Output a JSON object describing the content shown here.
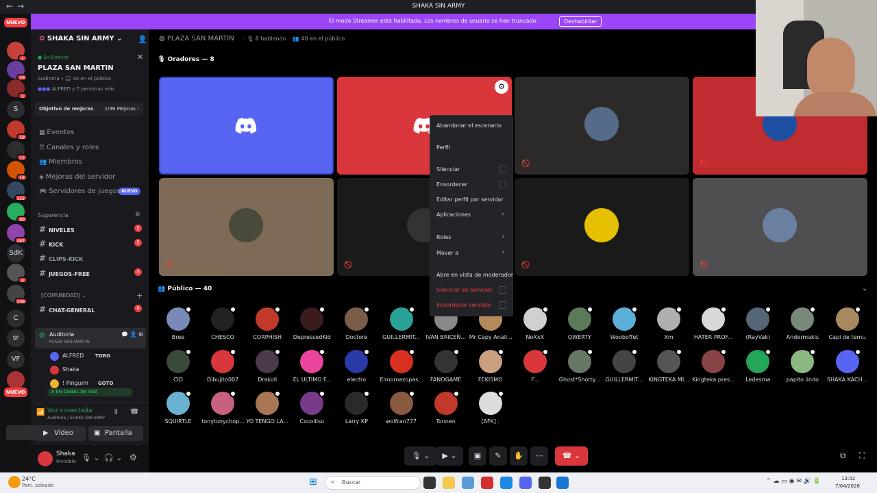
{
  "window": {
    "title": "SHAKA SIN ARMY",
    "back": "←",
    "forward": "→"
  },
  "banner": {
    "message": "El modo Streamer está habilitado. Los nombres de usuario se han truncado.",
    "button": "Deshabilitar"
  },
  "guilds": {
    "nuevo_top": "NUEVO",
    "nuevo_bottom": "NUEVO",
    "items": [
      {
        "label": "",
        "badge": "1",
        "color": "#c7403a"
      },
      {
        "label": "",
        "badge": "26",
        "color": "#6b3fa0"
      },
      {
        "label": "",
        "badge": "1",
        "color": "#8a2a2a"
      },
      {
        "label": "S",
        "badge": "",
        "color": "#2b2d31"
      },
      {
        "label": "",
        "badge": "19",
        "color": "#c0392b"
      },
      {
        "label": "",
        "badge": "12",
        "color": "#2d2d2d"
      },
      {
        "label": "",
        "badge": "18",
        "color": "#d35400"
      },
      {
        "label": "",
        "badge": "115",
        "color": "#34495e"
      },
      {
        "label": "",
        "badge": "30",
        "color": "#27ae60"
      },
      {
        "label": "",
        "badge": "287",
        "color": "#8e44ad"
      },
      {
        "label": "SdK",
        "badge": "",
        "color": "#2b2d31"
      },
      {
        "label": "",
        "badge": "4",
        "color": "#555"
      },
      {
        "label": "",
        "badge": "256",
        "color": "#444"
      },
      {
        "label": "C",
        "badge": "",
        "color": "#2b2d31"
      },
      {
        "label": "sr",
        "badge": "",
        "color": "#2b2d31"
      },
      {
        "label": "VF",
        "badge": "",
        "color": "#2b2d31"
      },
      {
        "label": "",
        "badge": "",
        "color": "#a33"
      }
    ]
  },
  "sidebar": {
    "server_name": "SHAKA SIN ARMY",
    "live_label": "En Directo",
    "stage_name": "PLAZA SAN MARTIN",
    "stage_meta": "Auditoria • 🎧 40 en el público",
    "stage_people": "ALFRED y 7 personas más",
    "boost_goal": "Objetivo de mejoras",
    "boost_count": "1/36 Mejoras",
    "menu": [
      {
        "label": "Eventos",
        "icon": "calendar-icon"
      },
      {
        "label": "Canales y roles",
        "icon": "list-icon"
      },
      {
        "label": "Miembros",
        "icon": "members-icon"
      },
      {
        "label": "Mejoras del servidor",
        "icon": "boost-icon"
      },
      {
        "label": "Servidores de juegos",
        "icon": "gamepad-icon"
      }
    ],
    "games_badge": "NUEVO",
    "suggestion_label": "Sugerencia",
    "channels": [
      {
        "name": "NIVELES",
        "badge": "2"
      },
      {
        "name": "KICK",
        "badge": "5"
      },
      {
        "name": "CLIPS-KICK",
        "badge": ""
      },
      {
        "name": "JUEGOS-FREE",
        "badge": "3"
      }
    ],
    "category": "[COMUNIDAD]",
    "general_channel": {
      "name": "CHAT-GENERAL",
      "badge": "4"
    },
    "voice_channel": {
      "name": "Auditoria",
      "sub": "PLAZA SAN MARTIN"
    },
    "voice_users": [
      {
        "name": "ALFRED",
        "tag": "TORO"
      },
      {
        "name": "Shaka",
        "tag": ""
      },
      {
        "name": "! Pinguim",
        "tag": "GOTO"
      }
    ],
    "in_voice_pill": "8 EN CANAL DE VOZ"
  },
  "voice_panel": {
    "status": "Voz conectada",
    "location": "Auditoria / SHAKA SIN ARMY",
    "video_button": "Video",
    "screen_button": "Pantalla"
  },
  "user_panel": {
    "name": "Shaka",
    "status": "Invisible"
  },
  "stage_header": {
    "name": "PLAZA SAN MARTIN",
    "speaking": "8 hablando",
    "audience": "40 en el público"
  },
  "speakers": {
    "title": "Oradores — 8",
    "tiles": [
      {
        "bg": "#5865f2",
        "kind": "logo",
        "muted": false
      },
      {
        "bg": "#da373c",
        "kind": "logo",
        "muted": false
      },
      {
        "bg": "#2b2a28",
        "kind": "avatar",
        "avatar_color": "#556b8a",
        "muted": true
      },
      {
        "bg": "#c02c2f",
        "kind": "avatar",
        "avatar_color": "#1f4fa3",
        "muted": true
      },
      {
        "bg": "#7d6b58",
        "kind": "avatar",
        "avatar_color": "#4a4a3a",
        "muted": true
      },
      {
        "bg": "#1a1a1a",
        "kind": "avatar",
        "avatar_color": "#333",
        "muted": true
      },
      {
        "bg": "#1a1a1a",
        "kind": "avatar",
        "avatar_color": "#e6c000",
        "muted": true
      },
      {
        "bg": "#4f4f52",
        "kind": "avatar",
        "avatar_color": "#6b7fa0",
        "muted": true
      }
    ]
  },
  "audience": {
    "title": "Público — 40",
    "members": [
      {
        "name": "Bree",
        "color": "#7a8ab8"
      },
      {
        "name": "CHESCO",
        "color": "#222"
      },
      {
        "name": "CORPHISH",
        "color": "#c0392b"
      },
      {
        "name": "DepressedKid",
        "color": "#3a1c1c"
      },
      {
        "name": "Doctore",
        "color": "#7a5c48"
      },
      {
        "name": "GUILLERMIT...",
        "color": "#2aa198"
      },
      {
        "name": "IVAN BRICEÑ...",
        "color": "#888"
      },
      {
        "name": "Mr Capy Anali...",
        "color": "#b58a5a"
      },
      {
        "name": "NoXxX",
        "color": "#d0d0d0"
      },
      {
        "name": "QWERTY",
        "color": "#5a7a5a"
      },
      {
        "name": "Wooboffet",
        "color": "#5ab0d8"
      },
      {
        "name": "Xm",
        "color": "#b0b0b0"
      },
      {
        "name": "HATER PROF...",
        "color": "#d8d8d8"
      },
      {
        "name": "(RayVak)",
        "color": "#556677"
      },
      {
        "name": "Andermakis",
        "color": "#7a8a7a"
      },
      {
        "name": "Capi de temu",
        "color": "#a88860"
      },
      {
        "name": "CID",
        "color": "#3a4a3a"
      },
      {
        "name": "Dibujito007",
        "color": "#da373c"
      },
      {
        "name": "Drakoll",
        "color": "#4a3a4a"
      },
      {
        "name": "EL ULTIMO F...",
        "color": "#eb459e"
      },
      {
        "name": "electro",
        "color": "#2a3aa8"
      },
      {
        "name": "Elmomazopas...",
        "color": "#d83020"
      },
      {
        "name": "FANOGAME",
        "color": "#333"
      },
      {
        "name": "FEKISMO",
        "color": "#c9a080"
      },
      {
        "name": "F...",
        "color": "#da373c"
      },
      {
        "name": "Ghost*Shorty...",
        "color": "#667766"
      },
      {
        "name": "GUILLERMIT...",
        "color": "#444"
      },
      {
        "name": "KINGTEKA MI...",
        "color": "#555"
      },
      {
        "name": "Kingteka pres...",
        "color": "#884444"
      },
      {
        "name": "Ledesma",
        "color": "#23a55a"
      },
      {
        "name": "papito lindo",
        "color": "#8ab880"
      },
      {
        "name": "SHAKA KACH...",
        "color": "#5865f2"
      },
      {
        "name": "SQUIRTLE",
        "color": "#6ab0d0"
      },
      {
        "name": "tonytonychop...",
        "color": "#c86080"
      },
      {
        "name": "YO TENGO LA...",
        "color": "#aa7755"
      },
      {
        "name": "Cocolilso",
        "color": "#7a3a8a"
      },
      {
        "name": "Larry KP",
        "color": "#2a2a2a"
      },
      {
        "name": "wolfran777",
        "color": "#8a5a40"
      },
      {
        "name": "Tonnen",
        "color": "#c0392b"
      },
      {
        "name": "[AFK] .",
        "color": "#ddd"
      }
    ]
  },
  "context_menu": {
    "items": [
      {
        "label": "Abandonar el escenario",
        "type": "plain"
      },
      {
        "label": "Perfil",
        "type": "plain"
      },
      {
        "label": "Silenciar",
        "type": "check"
      },
      {
        "label": "Ensordecer",
        "type": "check"
      },
      {
        "label": "Editar perfil por servidor",
        "type": "plain"
      },
      {
        "label": "Aplicaciones",
        "type": "arrow"
      },
      {
        "label": "Roles",
        "type": "arrow"
      },
      {
        "label": "Mover a",
        "type": "arrow"
      },
      {
        "label": "Abre en vista de moderador",
        "type": "plain"
      },
      {
        "label": "Silenciar en servidor",
        "type": "check-red"
      },
      {
        "label": "Ensordecer servidor",
        "type": "check-red"
      }
    ]
  },
  "taskbar": {
    "weather_temp": "24°C",
    "weather_desc": "Parc. soleado",
    "search": "Buscar",
    "time": "13:02",
    "date": "7/04/2026"
  },
  "colors": {
    "accent": "#5865f2",
    "danger": "#da373c",
    "banner": "#9b45f8",
    "green": "#23a55a"
  }
}
